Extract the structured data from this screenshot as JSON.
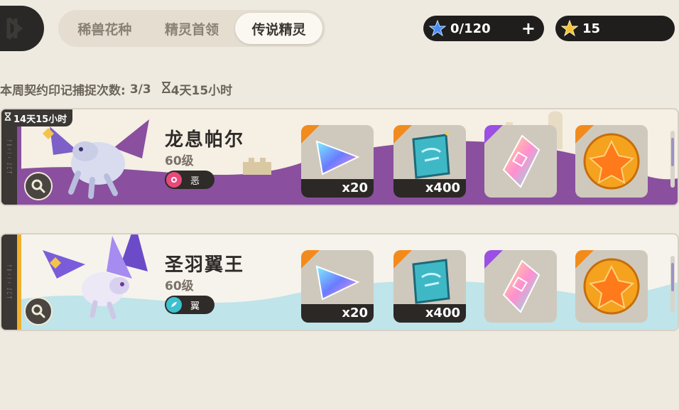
{
  "header": {
    "tabs": [
      {
        "label": "稀兽花种",
        "active": false
      },
      {
        "label": "精灵首领",
        "active": false
      },
      {
        "label": "传说精灵",
        "active": true
      }
    ],
    "resources": [
      {
        "icon": "blue-star-icon",
        "value": "0/120",
        "has_plus": true
      },
      {
        "icon": "gold-star-icon",
        "value": "15"
      }
    ]
  },
  "weekly": {
    "label": "本周契约印记捕捉次数:",
    "count": "3/3",
    "timer_icon": "hourglass-icon",
    "timer": "4天15小时"
  },
  "cards": [
    {
      "timer": "14天15小时",
      "name": "龙息帕尔",
      "level": "60级",
      "type": "恶",
      "type_color": "#e84a7a",
      "theme": "#8a4f9e",
      "rewards": [
        {
          "icon": "prism-crystal-icon",
          "qty": "x20",
          "rarity": "orange"
        },
        {
          "icon": "spell-book-icon",
          "qty": "x400",
          "rarity": "orange"
        },
        {
          "icon": "rainbow-gem-icon",
          "qty": "",
          "rarity": "purple"
        },
        {
          "icon": "amber-orb-icon",
          "qty": "",
          "rarity": "orange"
        }
      ]
    },
    {
      "timer": "",
      "name": "圣羽翼王",
      "level": "60级",
      "type": "翼",
      "type_color": "#3ec1cf",
      "theme": "#bfe4ea",
      "rewards": [
        {
          "icon": "prism-crystal-icon",
          "qty": "x20",
          "rarity": "orange"
        },
        {
          "icon": "spell-book-icon",
          "qty": "x400",
          "rarity": "orange"
        },
        {
          "icon": "rainbow-gem-icon",
          "qty": "",
          "rarity": "purple"
        },
        {
          "icon": "amber-orb-icon",
          "qty": "",
          "rarity": "orange"
        }
      ]
    }
  ]
}
